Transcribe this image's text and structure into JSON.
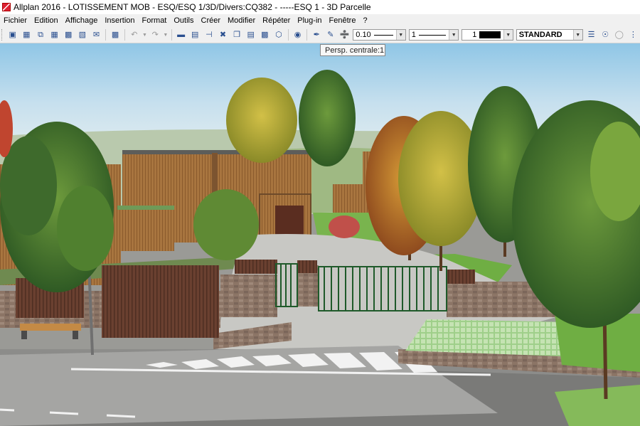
{
  "window": {
    "title": "Allplan 2016 - LOTISSEMENT MOB - ESQ/ESQ 1/3D/Divers:CQ382 - -----ESQ 1 - 3D Parcelle"
  },
  "menu": {
    "items": [
      "Fichier",
      "Edition",
      "Affichage",
      "Insertion",
      "Format",
      "Outils",
      "Créer",
      "Modifier",
      "Répéter",
      "Plug-in",
      "Fenêtre",
      "?"
    ]
  },
  "toolbar": {
    "pen_thickness": "0.10",
    "line_type": "1",
    "color": "1",
    "layer": "STANDARD",
    "icons": [
      "new-file-icon",
      "layer-icon",
      "open-icon",
      "save-icon",
      "print-icon",
      "archive-icon",
      "message-icon",
      "image-icon",
      "undo-icon",
      "redo-icon",
      "measure-icon",
      "ruler-icon",
      "dimension-icon",
      "cut-icon",
      "copy-icon",
      "paste-icon",
      "fill-icon",
      "cube-icon",
      "help-icon",
      "format-painter-icon",
      "pencil-icon",
      "eyedropper-icon",
      "layer-stack-icon",
      "layer-visibility-icon",
      "layer-lock-icon",
      "options-icon"
    ]
  },
  "tooltip": {
    "text": "Persp. centrale:1"
  },
  "viewport": {
    "description": "3D perspective of residential development"
  }
}
